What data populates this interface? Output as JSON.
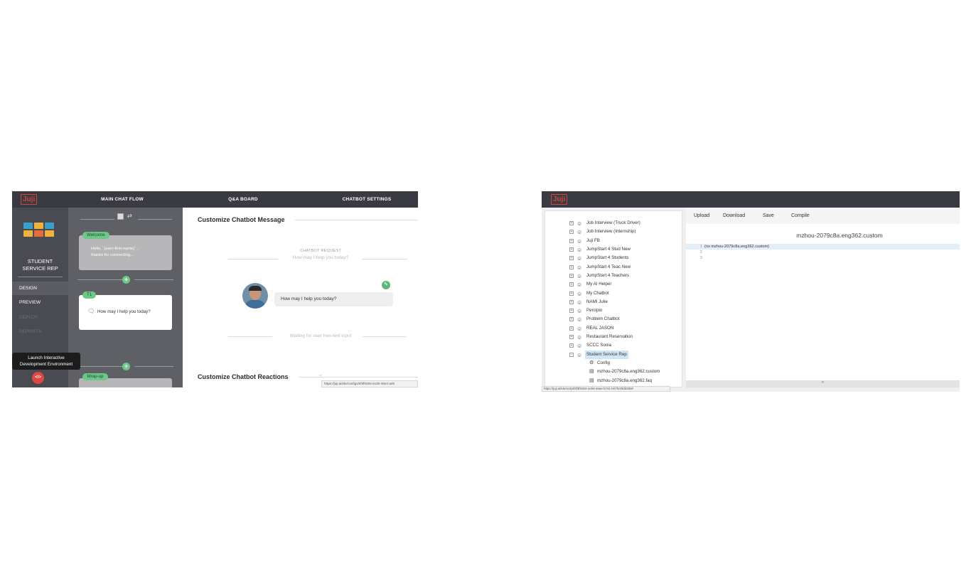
{
  "left": {
    "logo": "Juji",
    "nav": {
      "main_chat_flow": "MAIN CHAT FLOW",
      "qa_board": "Q&A BOARD",
      "chatbot_settings": "CHATBOT SETTINGS"
    },
    "bot_name_line1": "STUDENT",
    "bot_name_line2": "SERVICE REP",
    "sidebar_items": [
      "DESIGN",
      "PREVIEW",
      "DEPLOY",
      "REPORTS"
    ],
    "tooltip_line1": "Launch Interactive",
    "tooltip_line2": "Development Environment",
    "ide_button": "</>",
    "flow": {
      "welcome_badge": "Welcome",
      "welcome_text_line1": "Hello, `(user-first-name)` ,",
      "welcome_text_line2": "thanks for connecting...",
      "t1_badge": "T1",
      "t1_text": "How may I help you today?",
      "wrapup_badge": "Wrap-up",
      "plus": "+"
    },
    "main": {
      "customize_message_title": "Customize Chatbot Message",
      "chatbot_request_label": "CHATBOT REQUEST",
      "chatbot_request_text": "How may I help you today?",
      "bubble_text": "How may I help you today?",
      "waiting_text": "Waiting for user free-text input",
      "customize_reactions_title": "Customize Chatbot Reactions"
    },
    "status_url": "https://juji.ai/ide/configs/5f3f6284-6cd0-46e2-aeb"
  },
  "right": {
    "logo": "Juji",
    "tree": [
      "Job Interview (Truck Driver)",
      "Job Interview (Internship)",
      "Juji FB",
      "JumpStart 4 Stud New",
      "JumpStart 4 Students",
      "JumpStart 4 Teac New",
      "JumpStart 4 Teachers",
      "My AI Helper",
      "My Chatbot",
      "NAMI Julie",
      "Percipio",
      "Problem Chatbot",
      "REAL JASON",
      "Restaurant Reservation",
      "SCCC Sonia",
      "Student Service Rep"
    ],
    "tree_children": [
      "Config",
      "mzhou-2079c8a.eng362.custom",
      "mzhou-2079c8a.eng362.faq"
    ],
    "toolbar": {
      "upload": "Upload",
      "download": "Download",
      "save": "Save",
      "compile": "Compile"
    },
    "file_title": "mzhou-2079c8a.eng362.custom",
    "code_lines": [
      "(ns mzhou-2079c8a.eng362.custom)",
      "",
      ""
    ],
    "line_numbers": [
      "1",
      "2",
      "3"
    ],
    "collapse_symbol": "^",
    "status_url": "https://juji.ai/ide/script/5f3f6284-1eb8-48ae-b741-b07fe29dd28a#"
  },
  "colors": {
    "topbar": "#3a3b42",
    "sidebar": "#4a4b52",
    "accent_green": "#6cc788",
    "accent_red": "#e0473f",
    "selection_blue": "#cfe6f7"
  }
}
